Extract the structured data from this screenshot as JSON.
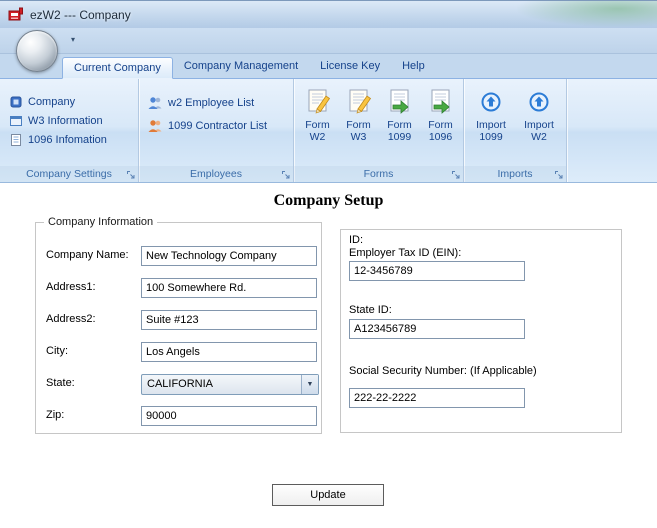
{
  "window": {
    "title": "ezW2 --- Company"
  },
  "icons": {
    "qat_dropdown": "▾",
    "combo_arrow": "▼"
  },
  "colors": {
    "ribbon_text": "#15428b",
    "app_icon_red": "#d11f26",
    "titlebar_blue": "#b6cce6"
  },
  "tabs": [
    {
      "label": "Current Company",
      "active": true
    },
    {
      "label": "Company Management",
      "active": false
    },
    {
      "label": "License Key",
      "active": false
    },
    {
      "label": "Help",
      "active": false
    }
  ],
  "ribbon": {
    "groups": [
      {
        "label": "Company Settings",
        "items": [
          {
            "label": "Company"
          },
          {
            "label": "W3 Information"
          },
          {
            "label": "1096 Infomation"
          }
        ]
      },
      {
        "label": "Employees",
        "items": [
          {
            "label": "w2 Employee List"
          },
          {
            "label": "1099 Contractor List"
          }
        ]
      },
      {
        "label": "Forms",
        "items": [
          {
            "line1": "Form",
            "line2": "W2"
          },
          {
            "line1": "Form",
            "line2": "W3"
          },
          {
            "line1": "Form",
            "line2": "1099"
          },
          {
            "line1": "Form",
            "line2": "1096"
          }
        ]
      },
      {
        "label": "Imports",
        "items": [
          {
            "line1": "Import",
            "line2": "1099"
          },
          {
            "line1": "Import",
            "line2": "W2"
          }
        ]
      }
    ]
  },
  "main": {
    "title": "Company Setup",
    "company_info": {
      "legend": "Company Information",
      "fields": [
        {
          "label": "Company Name:",
          "value": "New Technology Company"
        },
        {
          "label": "Address1:",
          "value": "100 Somewhere Rd."
        },
        {
          "label": "Address2:",
          "value": "Suite #123"
        },
        {
          "label": "City:",
          "value": "Los Angels"
        },
        {
          "label": "State:",
          "value": "CALIFORNIA"
        },
        {
          "label": "Zip:",
          "value": "90000"
        }
      ]
    },
    "ids": {
      "heading": "ID:",
      "fields": [
        {
          "label": "Employer Tax ID (EIN):",
          "value": "12-3456789"
        },
        {
          "label": "State ID:",
          "value": "A123456789"
        },
        {
          "label": "Social Security Number: (If Applicable)",
          "value": "222-22-2222"
        }
      ]
    },
    "update_button": "Update"
  }
}
